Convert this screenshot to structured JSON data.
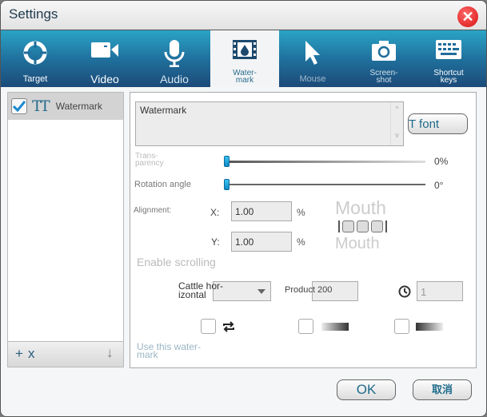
{
  "window": {
    "title": "Settings"
  },
  "tabs": [
    {
      "label": "Target",
      "icon": "crosshair-icon"
    },
    {
      "label": "Video",
      "icon": "video-camera-icon"
    },
    {
      "label": "Audio",
      "icon": "microphone-icon"
    },
    {
      "label": "Water-\nmark",
      "icon": "watermark-film-icon",
      "active": true
    },
    {
      "label": "Mouse",
      "icon": "cursor-icon"
    },
    {
      "label": "Screen-\nshot",
      "icon": "camera-icon"
    },
    {
      "label": "Shortcut\nkeys",
      "icon": "keyboard-icon"
    }
  ],
  "sidebar": {
    "items": [
      {
        "label": "Watermark",
        "checked": true
      }
    ],
    "add_label": "+",
    "remove_label": "x",
    "down_label": "↓"
  },
  "main": {
    "text_value": "Watermark",
    "font_button": "T font",
    "transparency_label": "Trans-\nparency",
    "transparency_value": "0%",
    "transparency_fraction": 0,
    "rotation_label": "Rotation angle",
    "rotation_value": "0°",
    "rotation_fraction": 0,
    "alignment_label": "Alignment:",
    "x_label": "X:",
    "x_value": "1.00",
    "x_unit": "%",
    "y_label": "Y:",
    "y_value": "1.00",
    "y_unit": "%",
    "preview_top": "Mouth",
    "preview_bottom": "Mouth",
    "scrolling_label": "Enable scrolling",
    "scroll_direction": "Cattle hor-\nizontal",
    "product_label": "Product 200",
    "timer_value": "1",
    "use_label": "Use this water-\nmark"
  },
  "footer": {
    "ok": "OK",
    "cancel": "取消"
  },
  "colors": {
    "toolbar_top": "#2aa3c5",
    "toolbar_bottom": "#1c4a78",
    "accent": "#1e6b8a",
    "close": "#d80f0f"
  }
}
